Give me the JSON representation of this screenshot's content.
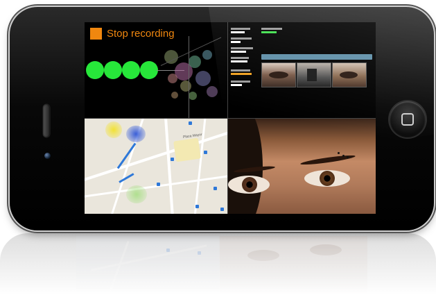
{
  "recording": {
    "stop_label": "Stop recording"
  },
  "colors": {
    "accent": "#f0870f",
    "signal_green": "#27e73a",
    "map_pin": "#2e78d8"
  },
  "map": {
    "street_label": "Plaza Mayor"
  },
  "icons": [
    "stop-icon",
    "home-button-icon",
    "map-location-icon"
  ]
}
